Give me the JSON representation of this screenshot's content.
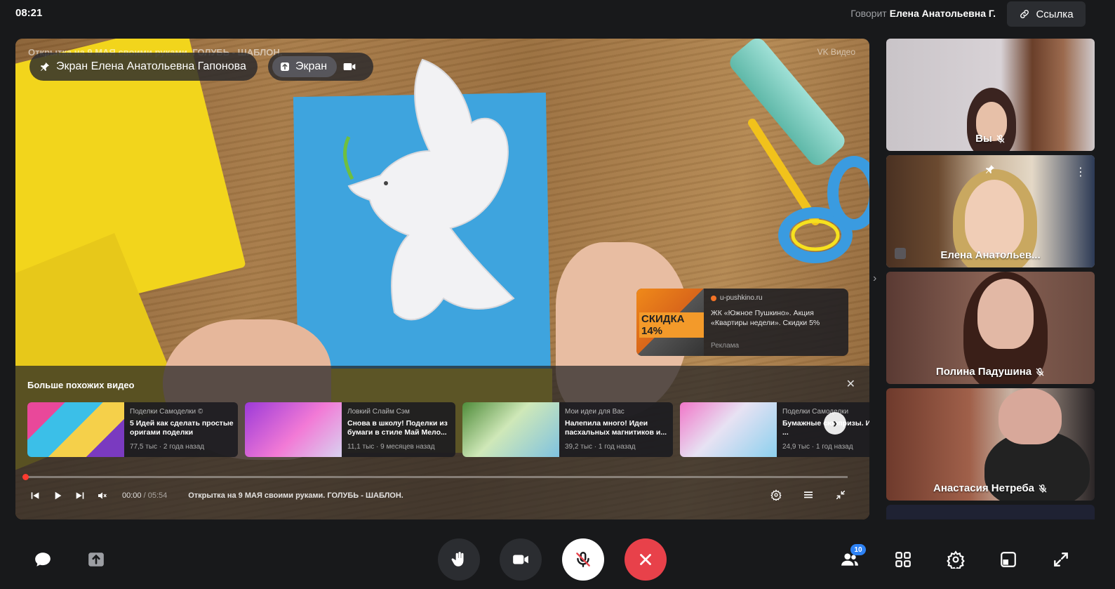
{
  "header": {
    "time": "08:21",
    "speaking_label": "Говорит",
    "speaking_name": "Елена Анатольевна Г.",
    "link_button": "Ссылка"
  },
  "stage": {
    "pinned_label": "Экран Елена Анатольевна Гапонова",
    "screen_tag": "Экран",
    "video_title_overlay": "Открытка на 9 МАЯ своими руками. ГОЛУБЬ - ШАБЛОН.",
    "vk_label": "VK Видео",
    "ad": {
      "image_text": "СКИДКА 14%",
      "source": "u-pushkino.ru",
      "text": "ЖК «Южное Пушкино». Акция «Квартиры недели». Скидки 5%",
      "label": "Реклама"
    },
    "similar": {
      "title": "Больше похожих видео",
      "close": "✕",
      "next": "›",
      "cards": [
        {
          "channel": "Поделки Самоделки ©",
          "title": "5 Идей как сделать простые оригами поделки",
          "meta": "77,5 тыс · 2 года назад"
        },
        {
          "channel": "Ловкий Слайм Сэм",
          "title": "Снова в школу! Поделки из бумаги в стиле Май Мело...",
          "meta": "11,1 тыс · 9 месяцев назад"
        },
        {
          "channel": "Мои идеи для Вас",
          "title": "Налепила много! Идеи пасхальных магнитиков и...",
          "meta": "39,2 тыс · 1 год назад"
        },
        {
          "channel": "Поделки Самоделки",
          "title": "Бумажные сюрпризы. Идеи ...",
          "meta": "24,9 тыс · 1 год назад"
        }
      ]
    },
    "player": {
      "time_current": "00:00",
      "time_sep": " / ",
      "time_total": "05:54",
      "title": "Открытка на 9 МАЯ своими руками. ГОЛУБЬ - ШАБЛОН.",
      "progress": 0.0
    }
  },
  "participants": [
    {
      "name": "Вы",
      "muted": true
    },
    {
      "name": "Елена Анатольев...",
      "muted": false,
      "pinned": true,
      "sharing": true
    },
    {
      "name": "Полина Падушина",
      "muted": true
    },
    {
      "name": "Анастасия Нетреба",
      "muted": true
    }
  ],
  "toolbar": {
    "participants_count": "10"
  },
  "colors": {
    "background": "#18191b",
    "end_call": "#e8414a",
    "badge": "#2d82f5"
  }
}
